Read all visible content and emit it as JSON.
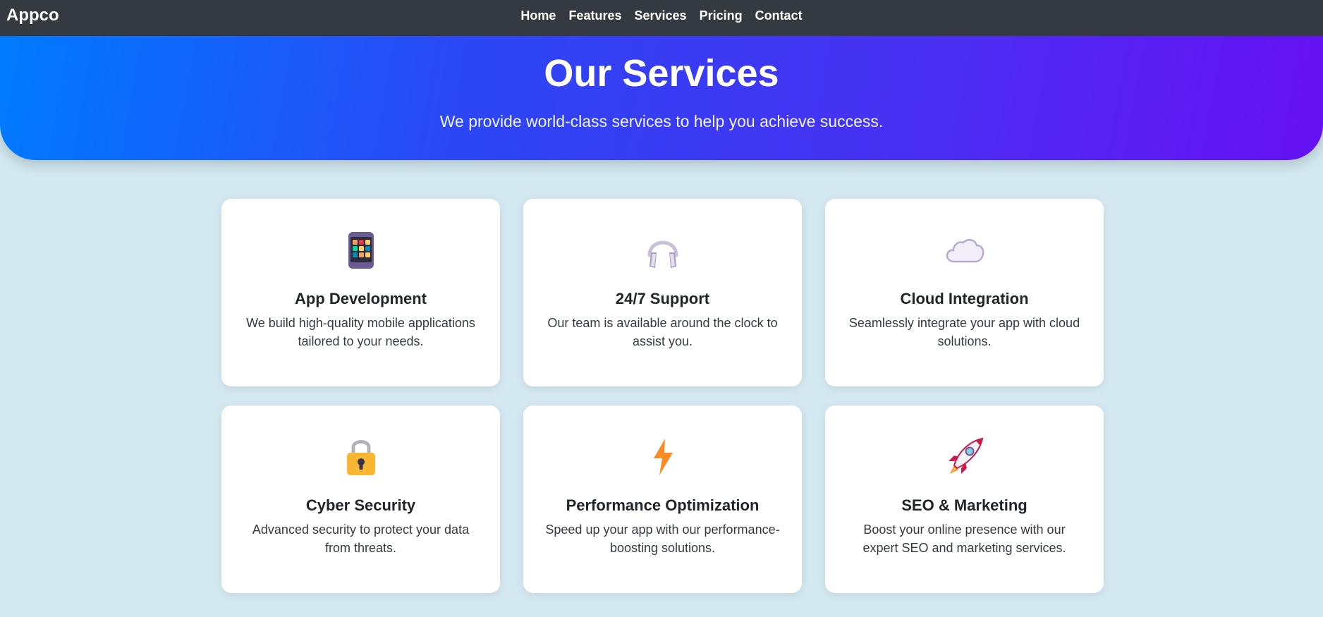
{
  "navbar": {
    "brand": "Appco",
    "links": [
      "Home",
      "Features",
      "Services",
      "Pricing",
      "Contact"
    ]
  },
  "hero": {
    "title": "Our Services",
    "subtitle": "We provide world-class services to help you achieve success."
  },
  "services": [
    {
      "icon": "tablet-apps-icon",
      "title": "App Development",
      "description": "We build high-quality mobile applications tailored to your needs."
    },
    {
      "icon": "headphones-icon",
      "title": "24/7 Support",
      "description": "Our team is available around the clock to assist you."
    },
    {
      "icon": "cloud-icon",
      "title": "Cloud Integration",
      "description": "Seamlessly integrate your app with cloud solutions."
    },
    {
      "icon": "lock-icon",
      "title": "Cyber Security",
      "description": "Advanced security to protect your data from threats."
    },
    {
      "icon": "lightning-icon",
      "title": "Performance Optimization",
      "description": "Speed up your app with our performance-boosting solutions."
    },
    {
      "icon": "rocket-icon",
      "title": "SEO & Marketing",
      "description": "Boost your online presence with our expert SEO and marketing services."
    }
  ],
  "colors": {
    "navbar": "#343a40",
    "hero_gradient_start": "#007bff",
    "hero_gradient_end": "#6610f2",
    "page_background": "#d3e8f0",
    "card_background": "#ffffff"
  }
}
